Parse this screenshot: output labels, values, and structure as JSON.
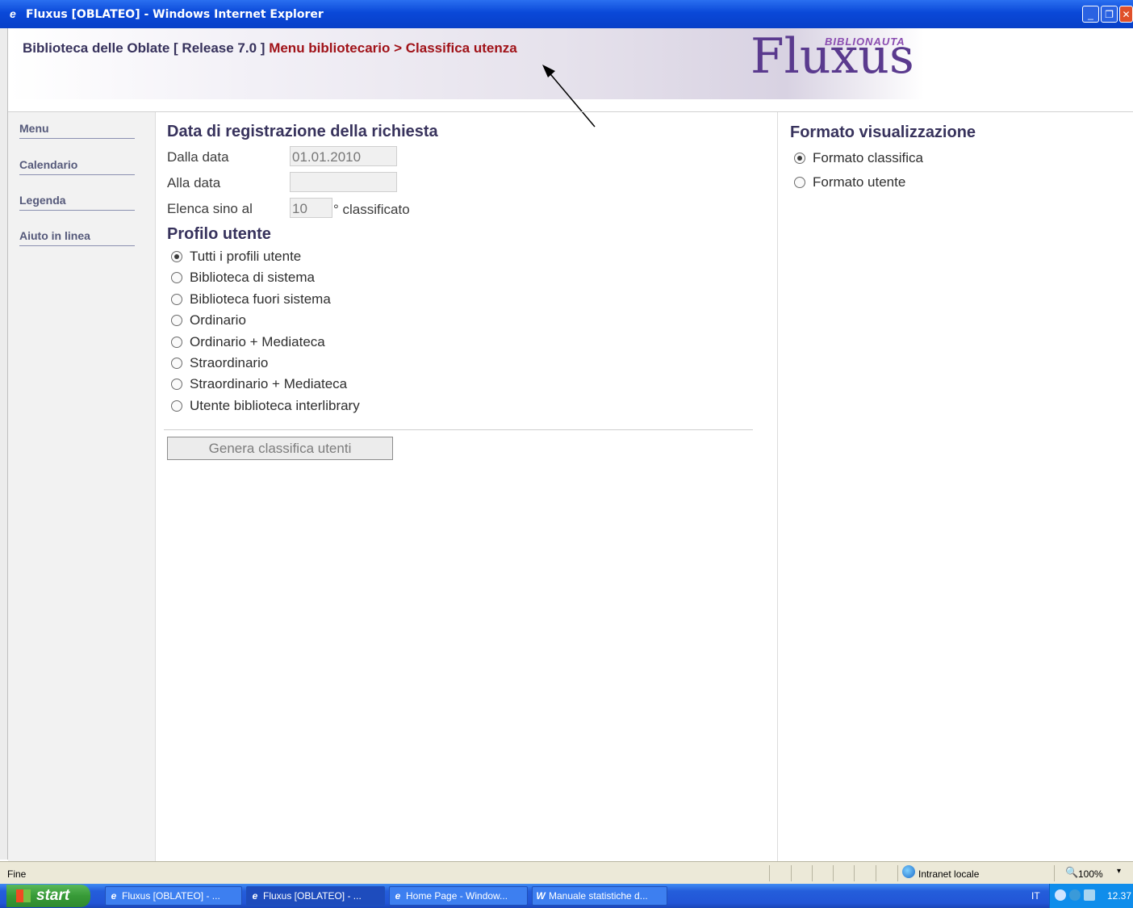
{
  "window": {
    "icon": "ie-logo-icon",
    "title": "Fluxus [OBLATEO] - Windows Internet Explorer",
    "controls": {
      "minimize": "_",
      "restore": "❐",
      "close": "✕"
    }
  },
  "header": {
    "library": "Biblioteca delle Oblate [ Release 7.0 ]",
    "menu_path": "Menu bibliotecario > Classifica utenza",
    "logo_small": "BIBLIONAUTA",
    "logo_big": "Fluxus"
  },
  "sidebar": {
    "items": [
      {
        "label": "Menu"
      },
      {
        "label": "Calendario"
      },
      {
        "label": "Legenda"
      },
      {
        "label": "Aiuto in linea"
      }
    ]
  },
  "registration": {
    "title": "Data di registrazione della richiesta",
    "from_label": "Dalla data",
    "from_value": "01.01.2010",
    "to_label": "Alla data",
    "to_value": "",
    "limit_label": "Elenca sino al",
    "limit_value": "10",
    "limit_suffix": "° classificato"
  },
  "profile": {
    "title": "Profilo utente",
    "options": [
      {
        "label": "Tutti i profili utente",
        "selected": true
      },
      {
        "label": "Biblioteca di sistema",
        "selected": false
      },
      {
        "label": "Biblioteca fuori sistema",
        "selected": false
      },
      {
        "label": "Ordinario",
        "selected": false
      },
      {
        "label": "Ordinario + Mediateca",
        "selected": false
      },
      {
        "label": "Straordinario",
        "selected": false
      },
      {
        "label": "Straordinario + Mediateca",
        "selected": false
      },
      {
        "label": "Utente biblioteca interlibrary",
        "selected": false
      }
    ]
  },
  "generate_button": "Genera classifica utenti",
  "format": {
    "title": "Formato visualizzazione",
    "options": [
      {
        "label": "Formato classifica",
        "selected": true
      },
      {
        "label": "Formato utente",
        "selected": false
      }
    ]
  },
  "statusbar": {
    "status": "Fine",
    "zone": "Intranet locale",
    "zoom": "100%",
    "zoom_dropdown": "▾"
  },
  "taskbar": {
    "start": "start",
    "tasks": [
      {
        "label": "Fluxus [OBLATEO] - ...",
        "icon": "ie-icon",
        "active": false
      },
      {
        "label": "Fluxus [OBLATEO] - ...",
        "icon": "ie-icon",
        "active": true
      },
      {
        "label": "Home Page - Window...",
        "icon": "ie-icon",
        "active": false
      },
      {
        "label": "Manuale statistiche d...",
        "icon": "word-icon",
        "active": false
      }
    ],
    "language": "IT",
    "clock": "12.37"
  }
}
